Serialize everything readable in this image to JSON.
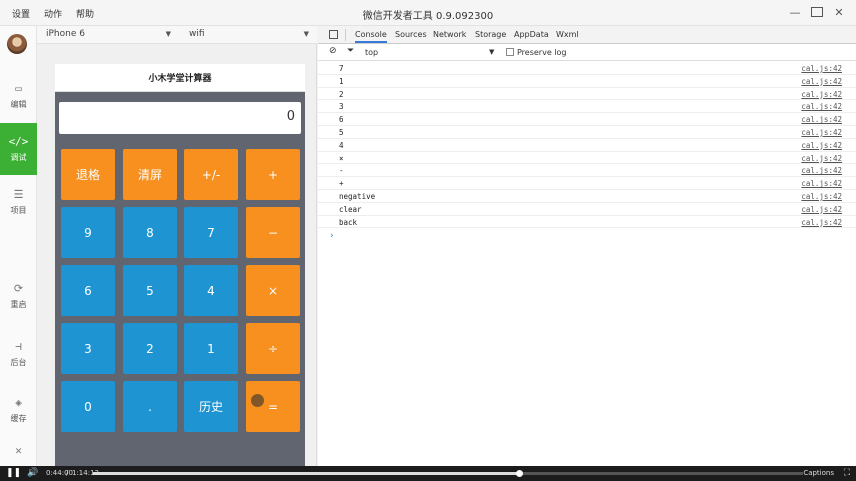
{
  "titlebar": {
    "menu": [
      "设置",
      "动作",
      "帮助"
    ],
    "title": "微信开发者工具 0.9.092300"
  },
  "sidebar": {
    "items": [
      {
        "label": "编辑",
        "icon": "code-window-icon"
      },
      {
        "label": "调试",
        "icon": "code-icon"
      },
      {
        "label": "项目",
        "icon": "menu-icon"
      },
      {
        "label": "重启",
        "icon": "restart-icon"
      },
      {
        "label": "后台",
        "icon": "background-icon"
      },
      {
        "label": "缓存",
        "icon": "layers-icon"
      },
      {
        "label": "关闭",
        "icon": "close-icon"
      }
    ]
  },
  "simulator": {
    "device": "iPhone 6",
    "network": "wifi",
    "page_title": "小木学堂计算器",
    "display_value": "0",
    "keys": [
      {
        "label": "退格",
        "color": "orange"
      },
      {
        "label": "清屏",
        "color": "orange"
      },
      {
        "label": "+/-",
        "color": "orange"
      },
      {
        "label": "+",
        "color": "orange"
      },
      {
        "label": "9",
        "color": "blue"
      },
      {
        "label": "8",
        "color": "blue"
      },
      {
        "label": "7",
        "color": "blue"
      },
      {
        "label": "−",
        "color": "orange"
      },
      {
        "label": "6",
        "color": "blue"
      },
      {
        "label": "5",
        "color": "blue"
      },
      {
        "label": "4",
        "color": "blue"
      },
      {
        "label": "×",
        "color": "orange"
      },
      {
        "label": "3",
        "color": "blue"
      },
      {
        "label": "2",
        "color": "blue"
      },
      {
        "label": "1",
        "color": "blue"
      },
      {
        "label": "÷",
        "color": "orange"
      },
      {
        "label": "0",
        "color": "blue"
      },
      {
        "label": ".",
        "color": "blue"
      },
      {
        "label": "历史",
        "color": "blue"
      },
      {
        "label": "=",
        "color": "orange"
      }
    ]
  },
  "devtools": {
    "tabs": [
      "Console",
      "Sources",
      "Network",
      "Storage",
      "AppData",
      "Wxml"
    ],
    "active_tab": "Console",
    "context": "top",
    "preserve_log_label": "Preserve log",
    "logs": [
      {
        "msg": "7",
        "src": "cal.js:42"
      },
      {
        "msg": "1",
        "src": "cal.js:42"
      },
      {
        "msg": "2",
        "src": "cal.js:42"
      },
      {
        "msg": "3",
        "src": "cal.js:42"
      },
      {
        "msg": "6",
        "src": "cal.js:42"
      },
      {
        "msg": "5",
        "src": "cal.js:42"
      },
      {
        "msg": "4",
        "src": "cal.js:42"
      },
      {
        "msg": "×",
        "src": "cal.js:42"
      },
      {
        "msg": "-",
        "src": "cal.js:42"
      },
      {
        "msg": "+",
        "src": "cal.js:42"
      },
      {
        "msg": "negative",
        "src": "cal.js:42"
      },
      {
        "msg": "clear",
        "src": "cal.js:42"
      },
      {
        "msg": "back",
        "src": "cal.js:42"
      }
    ],
    "prompt": "›"
  },
  "video": {
    "current_time": "0:44:00",
    "total_time": "1:14:13",
    "progress": 0.6,
    "captions_label": "Captions"
  },
  "colors": {
    "accent_green": "#3cb035",
    "key_orange": "#f7901e",
    "key_blue": "#1e94d2"
  }
}
